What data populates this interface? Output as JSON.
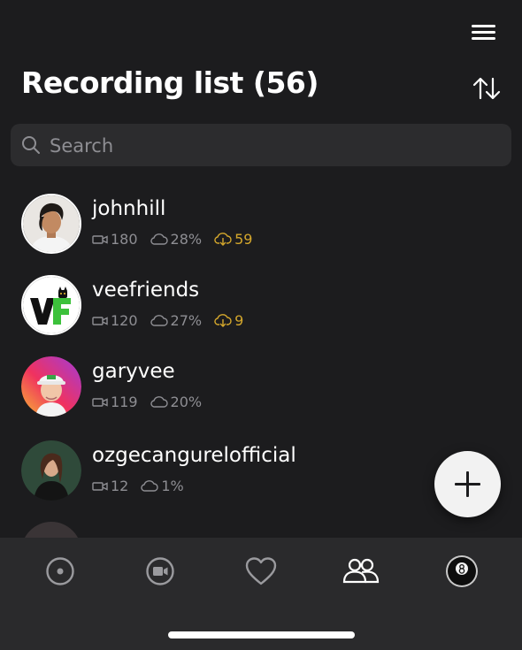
{
  "header": {
    "title": "Recording list (56)",
    "menu_icon": "hamburger-menu-icon",
    "sort_icon": "sort-arrows-icon"
  },
  "search": {
    "placeholder": "Search",
    "value": "",
    "icon": "magnifier-icon"
  },
  "recordings": [
    {
      "name": "johnhill",
      "videos": "180",
      "cloud": "28%",
      "downloads": "59",
      "avatar": "avatar-johnhill"
    },
    {
      "name": "veefriends",
      "videos": "120",
      "cloud": "27%",
      "downloads": "9",
      "avatar": "avatar-veefriends-logo"
    },
    {
      "name": "garyvee",
      "videos": "119",
      "cloud": "20%",
      "downloads": null,
      "avatar": "avatar-garyvee"
    },
    {
      "name": "ozgecangurelofficial",
      "videos": "12",
      "cloud": "1%",
      "downloads": null,
      "avatar": "avatar-ozgecangurelofficial"
    }
  ],
  "fab": {
    "icon": "plus-icon"
  },
  "tabbar": {
    "tabs": [
      {
        "icon": "record-icon"
      },
      {
        "icon": "video-camera-icon"
      },
      {
        "icon": "heart-icon"
      },
      {
        "icon": "people-icon",
        "active": true
      },
      {
        "icon": "profile-eight-ball-icon"
      }
    ]
  },
  "colors": {
    "background": "#1c1c1e",
    "search_background": "#2c2c2e",
    "tabbar_background": "#2a2a2c",
    "muted_text": "#8e8e93",
    "download_accent": "#d4a72c",
    "fab_background": "#f2f2f2"
  }
}
